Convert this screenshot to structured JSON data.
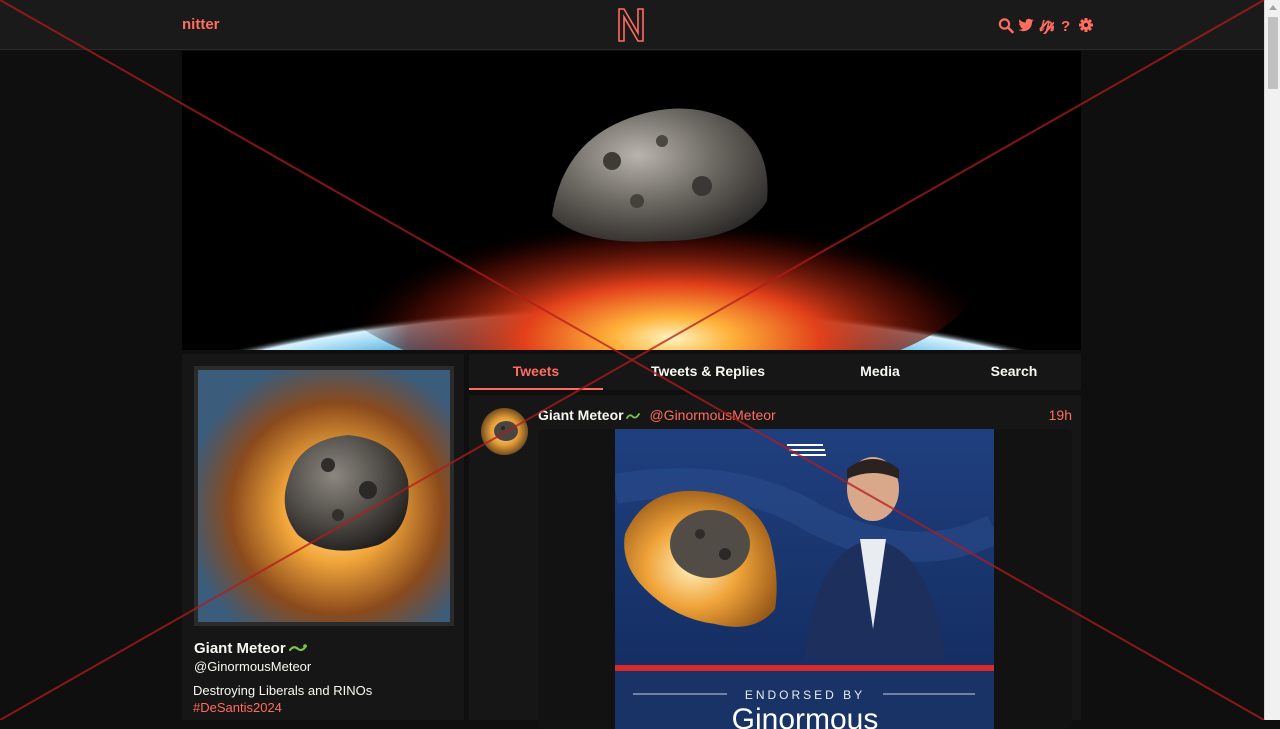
{
  "nav": {
    "brand": "nitter",
    "icons": [
      "search-icon",
      "twitter-icon",
      "rss-icon",
      "help-icon",
      "settings-icon"
    ]
  },
  "colors": {
    "accent": "#ff6c60",
    "background": "#0f0f0f",
    "panel": "#161616",
    "nav_background": "#1a1a1a"
  },
  "profile": {
    "fullname": "Giant Meteor",
    "username": "@GinormousMeteor",
    "bio": "Destroying Liberals and RINOs",
    "hashtag": "#DeSantis2024"
  },
  "tabs": [
    {
      "label": "Tweets",
      "active": true
    },
    {
      "label": "Tweets & Replies",
      "active": false
    },
    {
      "label": "Media",
      "active": false
    },
    {
      "label": "Search",
      "active": false
    }
  ],
  "tweet": {
    "fullname": "Giant Meteor",
    "username": "@GinormousMeteor",
    "date": "19h",
    "media": {
      "heading": "ENDORSED BY",
      "subheading": "Ginormous"
    }
  }
}
